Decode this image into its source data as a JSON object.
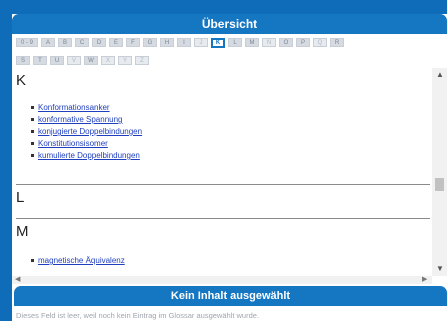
{
  "header": {
    "title": "Übersicht"
  },
  "alphabet": {
    "row1": [
      {
        "label": "0 - 9",
        "state": "normal"
      },
      {
        "label": "A",
        "state": "normal"
      },
      {
        "label": "B",
        "state": "normal"
      },
      {
        "label": "C",
        "state": "normal"
      },
      {
        "label": "D",
        "state": "normal"
      },
      {
        "label": "E",
        "state": "normal"
      },
      {
        "label": "F",
        "state": "normal"
      },
      {
        "label": "G",
        "state": "normal"
      },
      {
        "label": "H",
        "state": "normal"
      },
      {
        "label": "I",
        "state": "normal"
      },
      {
        "label": "J",
        "state": "off"
      },
      {
        "label": "K",
        "state": "active"
      },
      {
        "label": "L",
        "state": "normal"
      },
      {
        "label": "M",
        "state": "normal"
      },
      {
        "label": "N",
        "state": "off"
      },
      {
        "label": "O",
        "state": "normal"
      },
      {
        "label": "P",
        "state": "normal"
      },
      {
        "label": "Q",
        "state": "off"
      },
      {
        "label": "R",
        "state": "normal"
      }
    ],
    "row2": [
      {
        "label": "S",
        "state": "normal"
      },
      {
        "label": "T",
        "state": "normal"
      },
      {
        "label": "U",
        "state": "normal"
      },
      {
        "label": "V",
        "state": "off"
      },
      {
        "label": "W",
        "state": "normal"
      },
      {
        "label": "X",
        "state": "off"
      },
      {
        "label": "Y",
        "state": "off"
      },
      {
        "label": "Z",
        "state": "off"
      }
    ]
  },
  "sections": {
    "k": {
      "letter": "K",
      "entries": [
        "Konformationsanker",
        "konformative Spannung",
        "konjugierte Doppelbindungen",
        "Konstitutionsisomer",
        "kumulierte Doppelbindungen"
      ]
    },
    "l": {
      "letter": "L",
      "entries": []
    },
    "m": {
      "letter": "M",
      "entries": [
        "magnetische Äquivalenz"
      ]
    }
  },
  "scrollbar": {
    "up_icon": "arrow-up-icon",
    "down_icon": "arrow-down-icon"
  },
  "detail": {
    "title": "Kein Inhalt ausgewählt",
    "message": "Dieses Feld ist leer, weil noch kein Eintrag im Glossar ausgewählt wurde."
  },
  "colors": {
    "accent": "#1576c2",
    "background": "#0f6cb8",
    "link": "#1f3fbf"
  }
}
